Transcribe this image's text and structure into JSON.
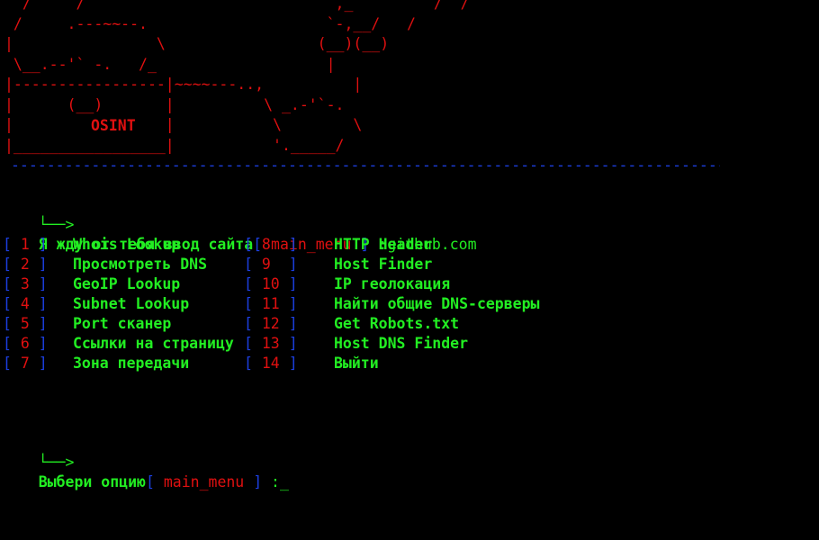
{
  "banner": {
    "logo_art": "  /     /                            ,_         /  /\n /     .---~~--.                    `-,__/   /\n|                \\                 (__)(__)\n \\__.--'` -.   /_                   |\n|-----------------|~~~~---..,          |\n|      (__)       |          \\ _.-'`-.\n|                 |           \\        \\\n|_________________|           '._____/",
    "logo_label": "OSINT",
    "divider": "----------------------------------------------------------------------------------------------------"
  },
  "prompt_site": {
    "arrow": "└──>",
    "text": "Я жду от тебя ввод сайта",
    "bracket_open": "[",
    "menu_tag": " main_menu ",
    "bracket_close": "]",
    "separator": " :",
    "value": "github.com"
  },
  "menu": {
    "left": [
      {
        "number": " 1 ",
        "label": "Whois Lookup"
      },
      {
        "number": " 2 ",
        "label": "Просмотреть DNS"
      },
      {
        "number": " 3 ",
        "label": "GeoIP Lookup"
      },
      {
        "number": " 4 ",
        "label": "Subnet Lookup"
      },
      {
        "number": " 5 ",
        "label": "Port сканер"
      },
      {
        "number": " 6 ",
        "label": "Ссылки на страницу"
      },
      {
        "number": " 7 ",
        "label": "Зона передачи"
      }
    ],
    "right": [
      {
        "number": " 8  ",
        "label": "HTTP Header"
      },
      {
        "number": " 9  ",
        "label": "Host Finder"
      },
      {
        "number": " 10 ",
        "label": "IP геолокация"
      },
      {
        "number": " 11 ",
        "label": "Найти общие DNS-серверы"
      },
      {
        "number": " 12 ",
        "label": "Get Robots.txt"
      },
      {
        "number": " 13 ",
        "label": "Host DNS Finder"
      },
      {
        "number": " 14 ",
        "label": "Выйти"
      }
    ]
  },
  "prompt_option": {
    "arrow": "└──>",
    "text": "Выбери опцию",
    "bracket_open": "[",
    "menu_tag": " main_menu ",
    "bracket_close": "]",
    "separator": " :",
    "cursor": "_"
  },
  "colors": {
    "background": "#000000",
    "red": "#e01010",
    "green": "#22ee22",
    "blue": "#1c3fe0"
  }
}
